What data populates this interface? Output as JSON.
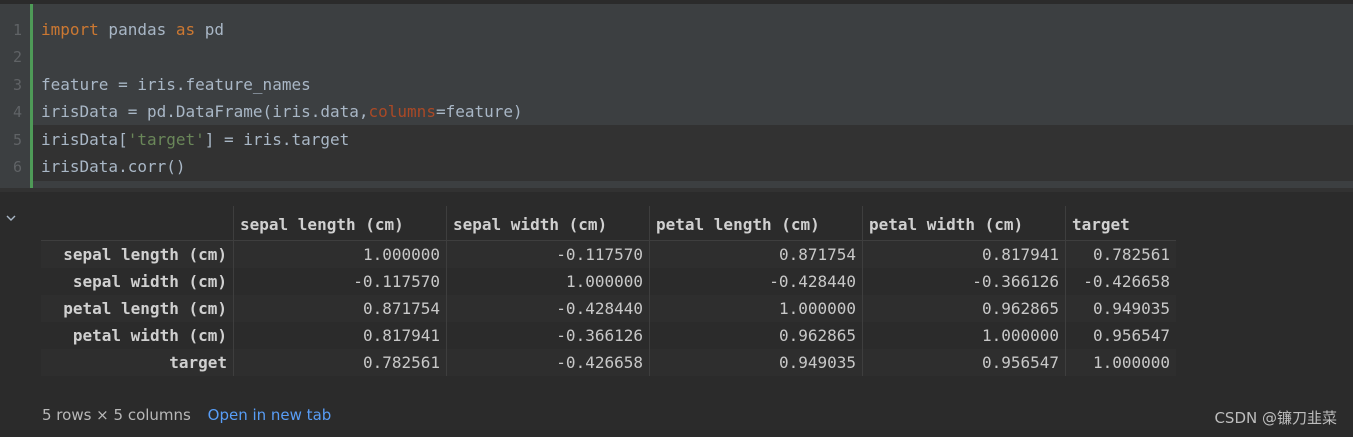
{
  "code_cell": {
    "line_numbers": [
      "1",
      "2",
      "3",
      "4",
      "5",
      "6"
    ],
    "lines": [
      {
        "parts": [
          {
            "t": "import",
            "c": "kw"
          },
          {
            "t": " pandas ",
            "c": ""
          },
          {
            "t": "as",
            "c": "kw"
          },
          {
            "t": " pd",
            "c": ""
          }
        ]
      },
      {
        "parts": []
      },
      {
        "parts": [
          {
            "t": "feature = iris.feature_names",
            "c": ""
          }
        ]
      },
      {
        "parts": [
          {
            "t": "irisData = pd.DataFrame(iris.data,",
            "c": ""
          },
          {
            "t": "columns",
            "c": "param"
          },
          {
            "t": "=feature)",
            "c": ""
          }
        ]
      },
      {
        "parts": [
          {
            "t": "irisData[",
            "c": ""
          },
          {
            "t": "'target'",
            "c": "str"
          },
          {
            "t": "] = iris.target",
            "c": ""
          }
        ]
      },
      {
        "parts": [
          {
            "t": "irisData.corr()",
            "c": ""
          }
        ]
      }
    ]
  },
  "output": {
    "collapse_icon": "chevron-down-icon",
    "columns": [
      "sepal length (cm)",
      "sepal width (cm)",
      "petal length (cm)",
      "petal width (cm)",
      "target"
    ],
    "rows": [
      {
        "index": "sepal length (cm)",
        "values": [
          "1.000000",
          "-0.117570",
          "0.871754",
          "0.817941",
          "0.782561"
        ]
      },
      {
        "index": "sepal width (cm)",
        "values": [
          "-0.117570",
          "1.000000",
          "-0.428440",
          "-0.366126",
          "-0.426658"
        ]
      },
      {
        "index": "petal length (cm)",
        "values": [
          "0.871754",
          "-0.428440",
          "1.000000",
          "0.962865",
          "0.949035"
        ]
      },
      {
        "index": "petal width (cm)",
        "values": [
          "0.817941",
          "-0.366126",
          "0.962865",
          "1.000000",
          "0.956547"
        ]
      },
      {
        "index": "target",
        "values": [
          "0.782561",
          "-0.426658",
          "0.949035",
          "0.956547",
          "1.000000"
        ]
      }
    ],
    "shape_text": "5 rows × 5 columns",
    "open_link": "Open in new tab"
  },
  "watermark": "CSDN @镰刀韭菜",
  "colors": {
    "accent_bar": "#4e9a57",
    "link": "#589df6",
    "keyword": "#cc7832",
    "string": "#6a8759"
  }
}
